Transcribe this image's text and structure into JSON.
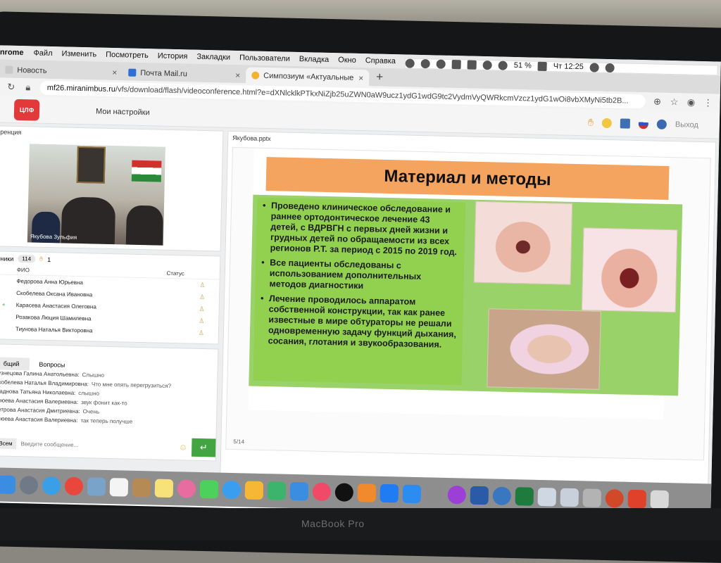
{
  "menubar": {
    "app": "nrome",
    "items": [
      "Файл",
      "Изменить",
      "Посмотреть",
      "История",
      "Закладки",
      "Пользователи",
      "Вкладка",
      "Окно",
      "Справка"
    ],
    "battery": "51 %",
    "clock": "Чт 12:25"
  },
  "tabs": [
    {
      "title": "Новость",
      "close": "×"
    },
    {
      "title": "Почта Mail.ru",
      "close": "×"
    },
    {
      "title": "Симпозиум «Актуальные",
      "close": "×"
    }
  ],
  "newtab": "+",
  "address": {
    "url_host": "mf26.miranimbus.ru",
    "url_path": "/vfs/download/flash/videoconference.html?e=dXNlcklkPTkxNiZjb25uZWN0aW9ucz1ydG1wdG9tc2VydmVyQWRkcmVzcz1ydG1wOi8vbXMyNi5tb2",
    "url_tail": "B..."
  },
  "app": {
    "logo": "ЦЛФ",
    "settings": "Мои настройки",
    "exit": "Выход"
  },
  "left": {
    "conference_title": "ренция",
    "video_name": "Якубова Зульфия",
    "participants_title": "тники",
    "participants_count": "114",
    "hands": "1",
    "col_fio": "ФИО",
    "col_status": "Статус",
    "rows": [
      "Федорова Анна Юрьевна",
      "Скобелева Оксана Ивановна",
      "Карасева Анастасия Олеговна",
      "Розакова Люция Шамилевна",
      "Тиунова Наталья Викторовна"
    ],
    "chat_title": "т",
    "chat_tabs": [
      "бщий",
      "Вопросы"
    ],
    "messages": [
      {
        "who": "Кузнецова Галина Анатольевна:",
        "text": "Слышно"
      },
      {
        "who": "Скобелева Наталья Владимировна:",
        "text": "Что мне опять перегрузиться?"
      },
      {
        "who": "Жаднова Татьяна Николаевна:",
        "text": "слышно"
      },
      {
        "who": "Клюева Анастасия Валериевна:",
        "text": "звук фонит как-то"
      },
      {
        "who": "Петрова Анастасия Дмитриевна:",
        "text": "Очень"
      },
      {
        "who": "Клюева Анастасия Валериевна:",
        "text": "так теперь получше"
      }
    ],
    "chat_select": "Всем",
    "chat_placeholder": "Введите сообщение...",
    "send_glyph": "↵"
  },
  "slide": {
    "file": "Якубова.pptx",
    "title": "Материал и методы",
    "bullets": [
      "Проведено клиническое обследование и раннее ортодонтическое лечение 43 детей, с ВДРВГН с первых дней жизни и грудных детей по обращаемости из всех регионов Р.Т. за период с 2015 по 2019 год.",
      "Все пациенты обследованы с использованием дополнительных методов диагностики",
      "Лечение проводилось аппаратом собственной конструкции, так как ранее известные в мире обтураторы не решали одновременную задачу функций дыхания, сосания, глотания и звукообразования."
    ],
    "page": "5/14"
  },
  "laptop_label": "MacBook Pro"
}
